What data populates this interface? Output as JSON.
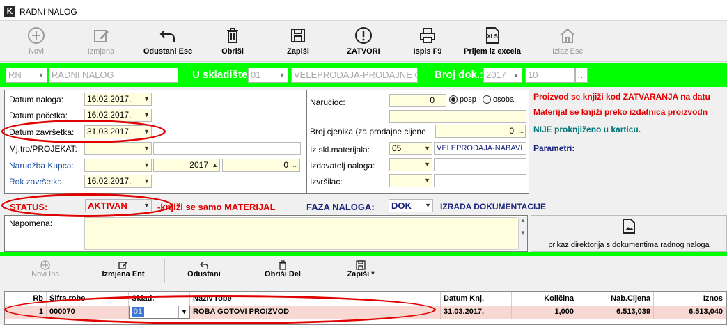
{
  "window": {
    "title": "RADNI NALOG"
  },
  "toolbar": {
    "novi": "Novi",
    "izmjena": "Izmjena",
    "odustani": "Odustani Esc",
    "obrisi": "Obriši",
    "zapisi": "Zapiši",
    "zatvori": "ZATVORI",
    "ispis": "Ispis F9",
    "prijem": "Prijem iz excela",
    "izlaz": "Izlaz Esc"
  },
  "header": {
    "type_code": "RN",
    "type_name": "RADNI NALOG",
    "skladiste_label": "U skladište",
    "skladiste_code": "01",
    "skladiste_name": "VELEPRODAJA-PRODAJNE C",
    "broj_label": "Broj dok.:",
    "broj_year": "2017",
    "broj_num": "10"
  },
  "form": {
    "datum_naloga_label": "Datum naloga:",
    "datum_naloga": "16.02.2017.",
    "datum_pocetka_label": "Datum početka:",
    "datum_pocetka": "16.02.2017.",
    "datum_zavrsetka_label": "Datum završetka:",
    "datum_zavrsetka": "31.03.2017.",
    "mjtro_label": "Mj.tro/PROJEKAT:",
    "narudzba_label": "Narudžba Kupca:",
    "narudzba_year": "2017",
    "narudzba_num": "0",
    "rok_label": "Rok završetka:",
    "rok": "16.02.2017.",
    "narucioc_label": "Naručioc:",
    "narucioc_val": "0",
    "posp_label": "posp",
    "osoba_label": "osoba",
    "broj_cjenika_label": "Broj cjenika (za prodajne cijene",
    "broj_cjenika_val": "0",
    "iz_skl_label": "Iz skl.materijala:",
    "iz_skl_code": "05",
    "iz_skl_name": "VELEPRODAJA-NABAVI",
    "izdavatelj_label": "Izdavatelj naloga:",
    "izvrsilac_label": "Izvršilac:",
    "ellipsis": "..."
  },
  "info": {
    "line1": "Proizvod se knjiži kod ZATVARANJA na datu",
    "line2": "Materijal se knjiži preko izdatnica proizvodn",
    "line3": "NIJE proknjiženo u karticu.",
    "params": "Parametri:"
  },
  "status": {
    "label": "STATUS:",
    "value": "AKTIVAN",
    "note": "-knjiži se samo MATERIJAL",
    "faza_label": "FAZA NALOGA:",
    "faza_code": "DOK",
    "faza_name": "IZRADA DOKUMENTACIJE"
  },
  "napomena_label": "Napomena:",
  "dir_button": "prikaz direktorija s dokumentima radnog naloga",
  "toolbar2": {
    "novi": "Novi Ins",
    "izmjena": "Izmjena Ent",
    "odustani": "Odustani",
    "obrisi": "Obriši Del",
    "zapisi": "Zapiši *"
  },
  "table": {
    "headers": [
      "Rb",
      "Šifra robe",
      "Sklad.",
      "Naziv robe",
      "Datum Knj.",
      "Količina",
      "Nab.Cijena",
      "Iznos"
    ],
    "rows": [
      {
        "rb": "1",
        "sifra": "000070",
        "sklad": "01",
        "naziv": "ROBA GOTOVI PROIZVOD",
        "datum": "31.03.2017.",
        "kolicina": "1,000",
        "cijena": "6.513,039",
        "iznos": "6.513,040"
      }
    ]
  }
}
